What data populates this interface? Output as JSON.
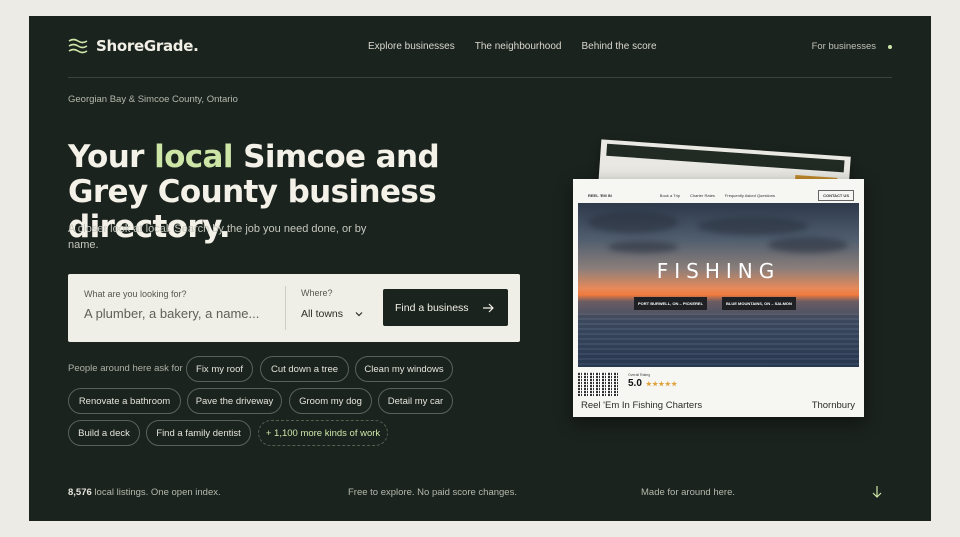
{
  "brand": {
    "name": "ShoreGrade."
  },
  "nav": {
    "items": [
      {
        "label": "Explore businesses"
      },
      {
        "label": "The neighbourhood"
      },
      {
        "label": "Behind the score"
      }
    ],
    "for_businesses": "For businesses"
  },
  "region": "Georgian Bay & Simcoe County, Ontario",
  "hero": {
    "title_before": "Your ",
    "title_highlight": "local",
    "title_after": " Simcoe and Grey County business directory.",
    "subtitle": "A closer look at local. Search by the job you need done, or by name."
  },
  "search": {
    "query_label": "What are you looking for?",
    "query_placeholder": "A plumber, a bakery, a name...",
    "where_label": "Where?",
    "where_value": "All towns",
    "button_label": "Find a business"
  },
  "suggestions": {
    "lead": "People around here ask for",
    "chips": [
      "Fix my roof",
      "Cut down a tree",
      "Clean my windows",
      "Renovate a bathroom",
      "Pave the driveway",
      "Groom my dog",
      "Detail my car",
      "Build a deck",
      "Find a family dentist"
    ],
    "more": "+ 1,100 more kinds of work"
  },
  "footer": {
    "count": "8,576",
    "count_suffix": " local listings. One open index.",
    "middle": "Free to explore. No paid score changes.",
    "right": "Made for around here."
  },
  "featured_card": {
    "site_name": "REEL 'EM IN",
    "site_nav": [
      "Book a Trip",
      "Charter Rates",
      "Frequently Asked Questions"
    ],
    "contact": "CONTACT US",
    "hero_word": "FISHING",
    "tags": [
      "PORT BURWELL, ON – PICKEREL",
      "BLUE MOUNTAINS, ON – SALMON"
    ],
    "rating_label": "Overall Rating",
    "rating": "5.0",
    "stars": "★★★★★",
    "name": "Reel 'Em In Fishing Charters",
    "town": "Thornbury"
  },
  "colors": {
    "background": "#1b231e",
    "accent": "#cde6a8",
    "surface": "#f0efe7"
  }
}
